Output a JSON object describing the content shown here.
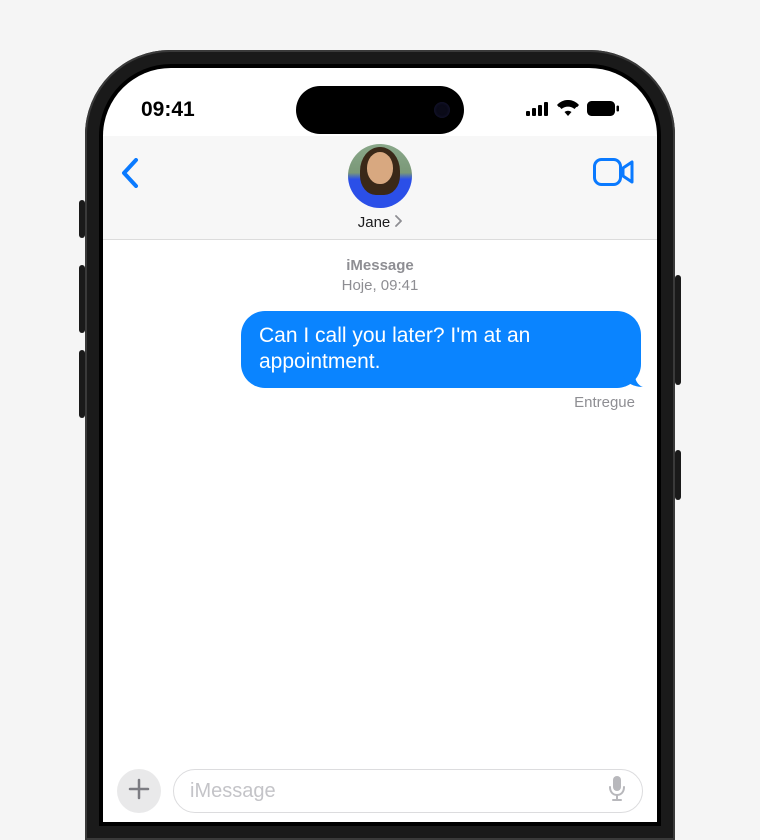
{
  "status": {
    "time": "09:41"
  },
  "header": {
    "contact_name": "Jane"
  },
  "conversation": {
    "service_label": "iMessage",
    "timestamp": "Hoje, 09:41",
    "messages": [
      {
        "text": "Can I call you later? I'm at an appointment.",
        "direction": "sent"
      }
    ],
    "delivery_status": "Entregue"
  },
  "compose": {
    "placeholder": "iMessage"
  },
  "colors": {
    "accent_blue": "#0A7AFF",
    "bubble_blue": "#0A84FF",
    "meta_gray": "#8E8E93"
  }
}
